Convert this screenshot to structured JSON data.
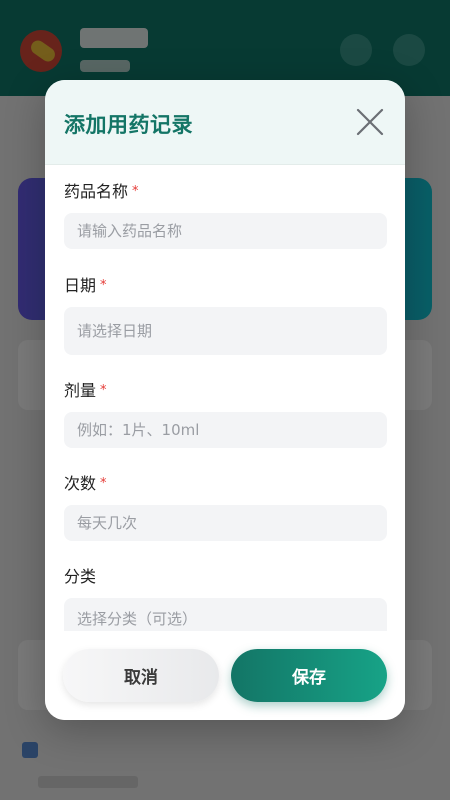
{
  "modal": {
    "title": "添加用药记录",
    "fields": [
      {
        "label": "药品名称",
        "required": "*",
        "placeholder": "请输入药品名称"
      },
      {
        "label": "日期",
        "required": "*",
        "placeholder": "请选择日期"
      },
      {
        "label": "剂量",
        "required": "*",
        "placeholder": "例如：1片、10ml"
      },
      {
        "label": "次数",
        "required": "*",
        "placeholder": "每天几次"
      },
      {
        "label": "分类",
        "placeholder": "选择分类（可选）"
      }
    ],
    "buttons": {
      "cancel": "取消",
      "save": "保存"
    }
  },
  "colors": {
    "accent": "#137566",
    "accent_light": "#17a387",
    "required": "#e53935",
    "input_bg": "#f3f4f6"
  },
  "icons": {
    "close": "close-icon"
  }
}
